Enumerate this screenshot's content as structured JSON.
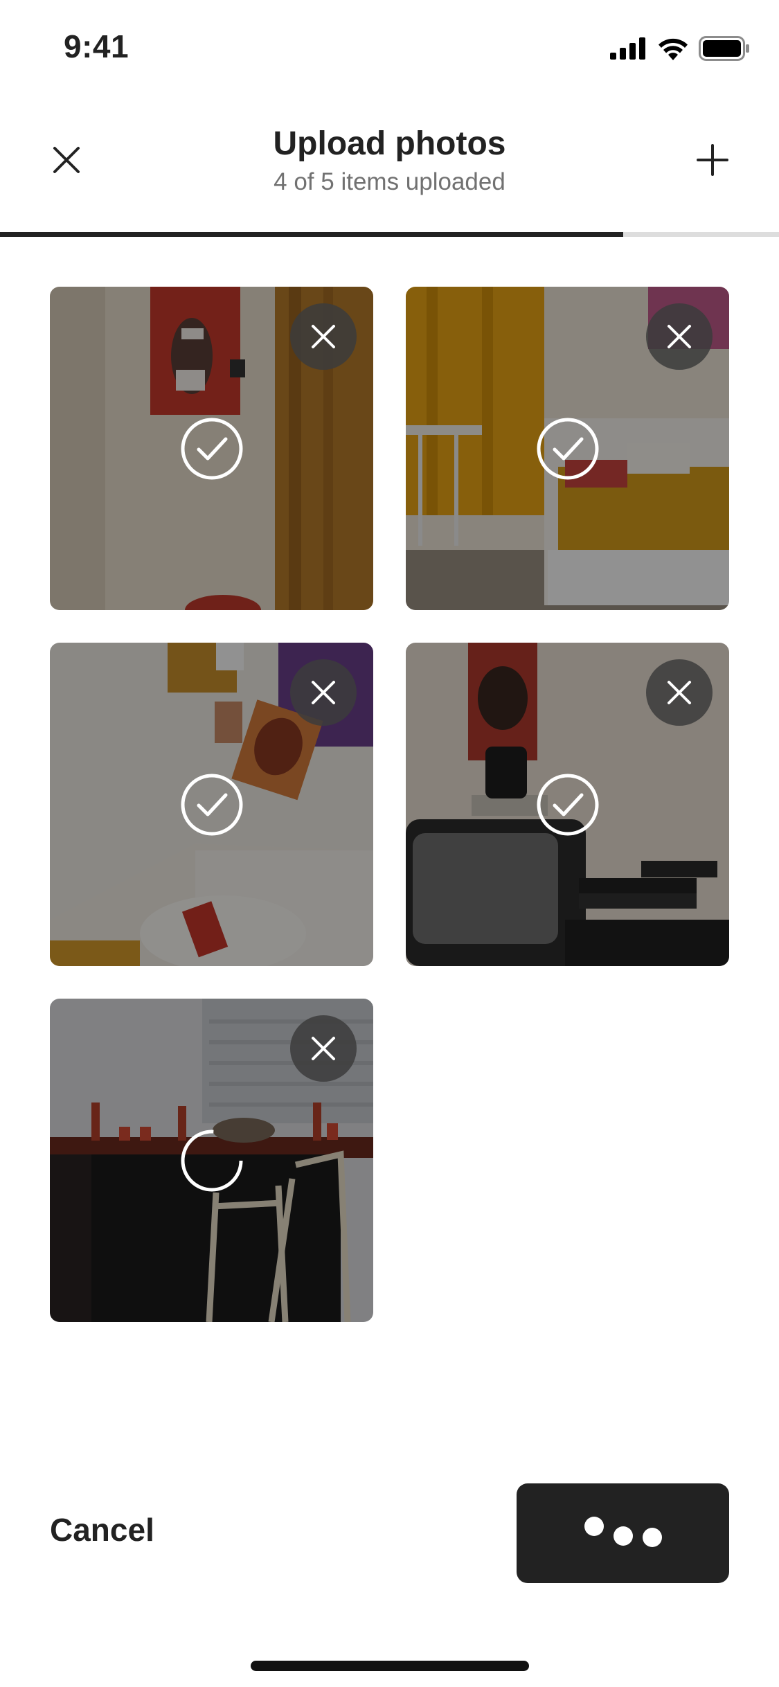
{
  "status_bar": {
    "time": "9:41"
  },
  "header": {
    "title": "Upload photos",
    "subtitle": "4 of 5 items uploaded",
    "progress_fraction": 0.8
  },
  "photos": [
    {
      "name": "bedroom-poster-curtain",
      "status": "uploaded"
    },
    {
      "name": "daybed-yellow-curtain",
      "status": "uploaded"
    },
    {
      "name": "wall-posters-pillows",
      "status": "uploaded"
    },
    {
      "name": "crt-tv-vhs-tapes",
      "status": "uploaded"
    },
    {
      "name": "dining-table-bottles",
      "status": "uploading"
    }
  ],
  "footer": {
    "cancel_label": "Cancel"
  },
  "colors": {
    "primary": "#222222",
    "secondary_text": "#717171",
    "progress_track": "#dddddd",
    "button_text": "#ffffff"
  }
}
